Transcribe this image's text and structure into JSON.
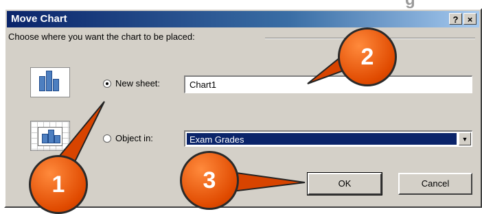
{
  "background_text": "g",
  "dialog": {
    "title": "Move Chart",
    "help_button": "?",
    "close_button": "×",
    "group_label": "Choose where you want the chart to be placed:",
    "new_sheet": {
      "label": "New sheet:",
      "selected": true,
      "value": "Chart1"
    },
    "object_in": {
      "label": "Object in:",
      "selected": false,
      "value": "Exam Grades"
    },
    "ok_label": "OK",
    "cancel_label": "Cancel"
  },
  "callouts": [
    "1",
    "2",
    "3"
  ],
  "colors": {
    "title_bar": "#0a246a",
    "dialog_bg": "#d4d0c8",
    "callout": "#e04a00",
    "selection": "#0a246a"
  },
  "icons": [
    "chart-sheet-icon",
    "embedded-chart-icon",
    "dropdown-arrow-icon",
    "help-icon",
    "close-icon"
  ]
}
